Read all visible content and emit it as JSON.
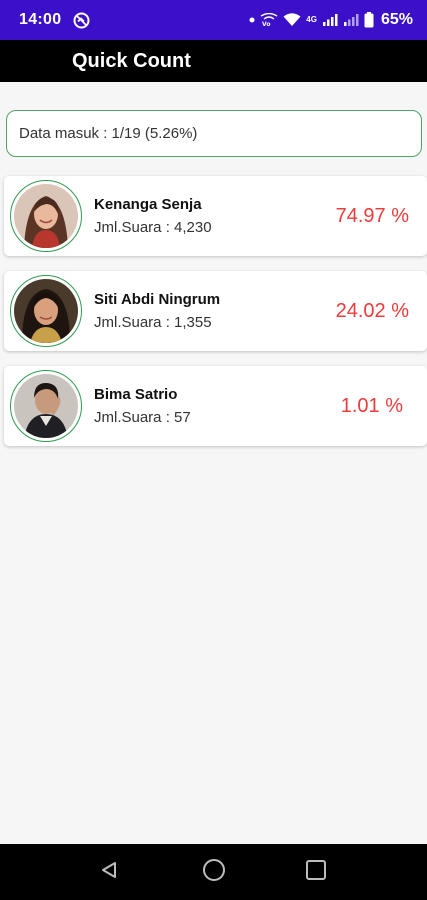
{
  "status_bar": {
    "time": "14:00",
    "network_label": "4G",
    "battery_percent": "65%",
    "icons": [
      "do-not-disturb-icon",
      "dot-icon",
      "vowifi-icon",
      "wifi-icon",
      "signal-icon",
      "signal-icon",
      "battery-icon"
    ]
  },
  "app_bar": {
    "title": "Quick Count"
  },
  "data_info": {
    "text": "Data masuk : 1/19 (5.26%)"
  },
  "candidates": [
    {
      "name": "Kenanga Senja",
      "votes": "Jml.Suara : 4,230",
      "percent": "74.97 %"
    },
    {
      "name": "Siti Abdi Ningrum",
      "votes": "Jml.Suara : 1,355",
      "percent": "24.02 %"
    },
    {
      "name": "Bima Satrio",
      "votes": "Jml.Suara : 57",
      "percent": "1.01 %"
    }
  ],
  "nav_bar": {
    "buttons": [
      "back-icon",
      "home-icon",
      "recents-icon"
    ]
  },
  "colors": {
    "status_bar": "#3b10c8",
    "app_bar": "#000000",
    "percent": "#ee3b3b",
    "accent_border": "#53a263"
  }
}
